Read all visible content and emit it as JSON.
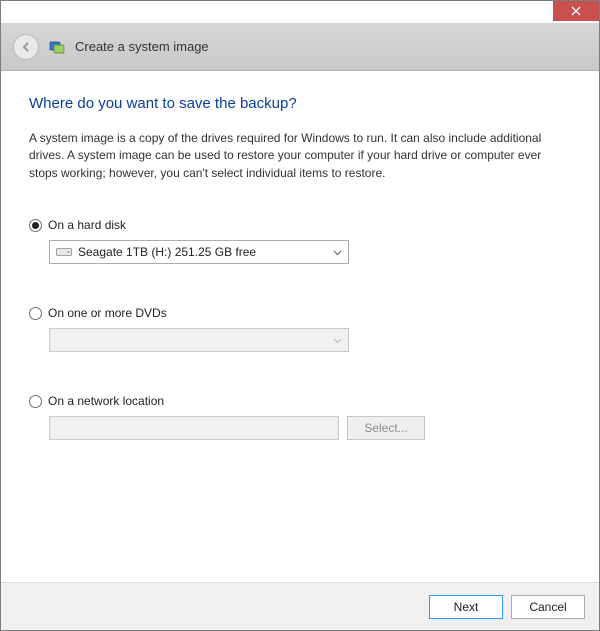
{
  "titlebar": {
    "close_tooltip": "Close"
  },
  "header": {
    "title": "Create a system image"
  },
  "content": {
    "question": "Where do you want to save the backup?",
    "description": "A system image is a copy of the drives required for Windows to run. It can also include additional drives. A system image can be used to restore your computer if your hard drive or computer ever stops working; however, you can't select individual items to restore."
  },
  "options": {
    "hard_disk": {
      "label": "On a hard disk",
      "selected_drive": "Seagate 1TB (H:)  251.25 GB free",
      "checked": true
    },
    "dvd": {
      "label": "On one or more DVDs",
      "selected_drive": "",
      "checked": false
    },
    "network": {
      "label": "On a network location",
      "path": "",
      "select_button": "Select...",
      "checked": false
    }
  },
  "footer": {
    "next_label": "Next",
    "cancel_label": "Cancel"
  }
}
